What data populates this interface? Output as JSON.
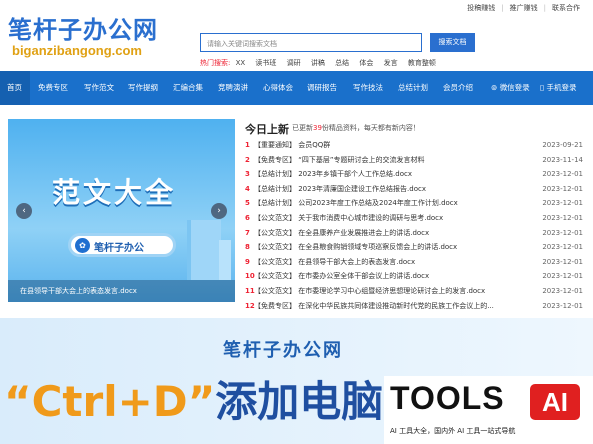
{
  "header": {
    "logo_cn": "笔杆子办公网",
    "logo_en": "biganzibangong.com",
    "top_links": [
      "投稿赚钱",
      "推广赚钱",
      "联系合作"
    ],
    "search_placeholder": "请输入关键词搜索文档",
    "search_button": "搜索文档",
    "hot_label": "热门搜索:",
    "hot_keywords": [
      "XX",
      "读书班",
      "调研",
      "讲稿",
      "总结",
      "体会",
      "发言",
      "教育整顿"
    ]
  },
  "nav": {
    "items": [
      "首页",
      "免费专区",
      "写作范文",
      "写作提纲",
      "汇编合集",
      "竞聘演讲",
      "心得体会",
      "调研报告",
      "写作技法",
      "总结计划",
      "会员介绍"
    ],
    "wechat_login": "微信登录",
    "phone_login": "手机登录"
  },
  "slider": {
    "title": "范文大全",
    "pill_text": "笔杆子办公",
    "caption": "在县领导干部大会上的表态发言.docx",
    "prev": "‹",
    "next": "›"
  },
  "latest": {
    "title": "今日上新",
    "note_prefix": "已更新",
    "note_count": "39",
    "note_suffix": "份精品资料，每天都有新内容！",
    "items": [
      {
        "idx": "1",
        "text": "【重要通知】 会员QQ群",
        "date": "2023-09-21"
      },
      {
        "idx": "2",
        "text": "【免费专区】 “四下基层”专题研讨会上的交流发言材料",
        "date": "2023-11-14"
      },
      {
        "idx": "3",
        "text": "【总结计划】 2023年乡镇干部个人工作总结.docx",
        "date": "2023-12-01"
      },
      {
        "idx": "4",
        "text": "【总结计划】 2023年清廉国企建设工作总结报告.docx",
        "date": "2023-12-01"
      },
      {
        "idx": "5",
        "text": "【总结计划】 公司2023年度工作总结及2024年度工作计划.docx",
        "date": "2023-12-01"
      },
      {
        "idx": "6",
        "text": "【公文范文】 关于我市消费中心城市建设的调研与思考.docx",
        "date": "2023-12-01"
      },
      {
        "idx": "7",
        "text": "【公文范文】 在全县康养产业发展推进会上的讲话.docx",
        "date": "2023-12-01"
      },
      {
        "idx": "8",
        "text": "【公文范文】 在全县粮食购销领域专项巡察反馈会上的讲话.docx",
        "date": "2023-12-01"
      },
      {
        "idx": "9",
        "text": "【公文范文】 在县领导干部大会上的表态发言.docx",
        "date": "2023-12-01"
      },
      {
        "idx": "10",
        "text": "【公文范文】 在市委办公室全体干部会议上的讲话.docx",
        "date": "2023-12-01"
      },
      {
        "idx": "11",
        "text": "【公文范文】 在市委理论学习中心组暨经济思想理论研讨会上的发言.docx",
        "date": "2023-12-01"
      },
      {
        "idx": "12",
        "text": "【免费专区】 在深化中华民族共同体建设推动新时代党的民族工作会议上的...",
        "date": "2023-12-01"
      }
    ]
  },
  "banner": {
    "title": "笔杆子办公网",
    "open_quote": "“",
    "ctrl": "Ctrl+D",
    "close_quote": "”",
    "text": "添加电脑"
  },
  "tools_logo": {
    "word": "TOOLS",
    "ai": "AI",
    "sub": "AI 工具大全，国内外 AI 工具一站式导航"
  },
  "colors": {
    "primary": "#1a70cb",
    "accent": "#e02020",
    "orange": "#f09a1a"
  }
}
